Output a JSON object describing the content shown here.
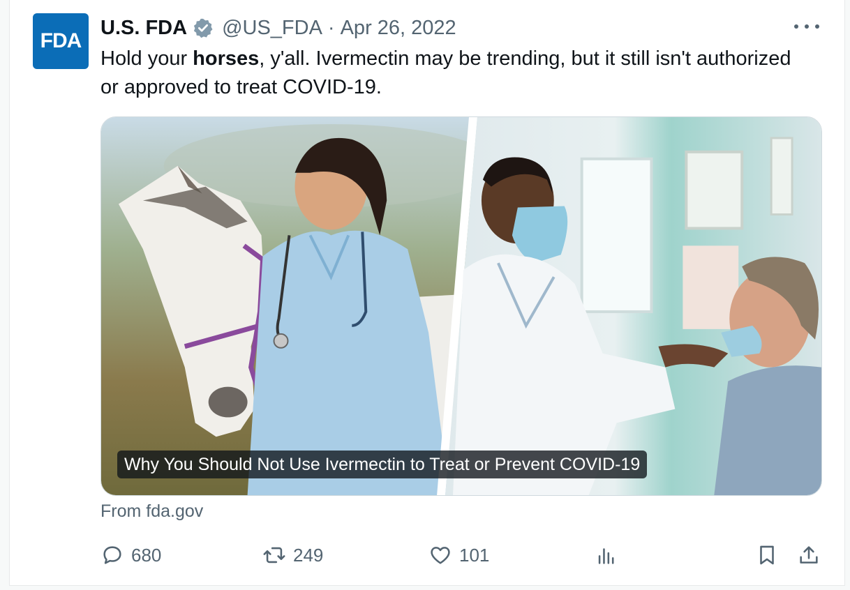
{
  "account": {
    "avatar_text": "FDA",
    "name": "U.S. FDA",
    "handle": "@US_FDA",
    "separator": "·",
    "date": "Apr 26, 2022"
  },
  "tweet": {
    "text_before": "Hold your ",
    "text_bold": "horses",
    "text_after": ", y'all. Ivermectin may be trending, but it still isn't authorized or approved to treat COVID-19."
  },
  "media": {
    "caption": "Why You Should Not Use Ivermectin to Treat or Prevent COVID-19",
    "source": "From fda.gov"
  },
  "actions": {
    "replies": "680",
    "retweets": "249",
    "likes": "101"
  },
  "colors": {
    "accent": "#1d9bf0",
    "avatar_bg": "#0b6db7",
    "muted_text": "#536471",
    "verified_badge": "#829aab"
  },
  "icons": [
    "verified-badge-icon",
    "more-icon",
    "reply-icon",
    "retweet-icon",
    "like-icon",
    "views-icon",
    "bookmark-icon",
    "share-icon"
  ]
}
